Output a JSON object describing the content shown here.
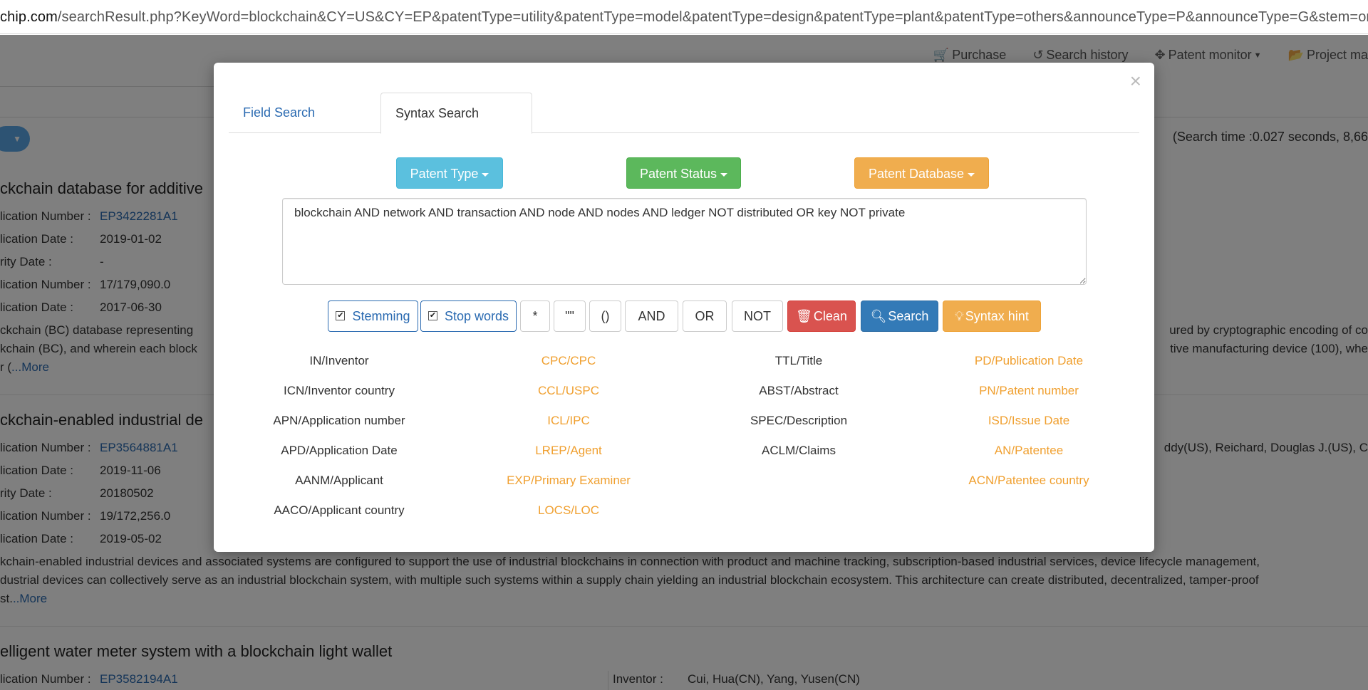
{
  "url": {
    "host": "chip.com",
    "path": "/searchResult.php?KeyWord=blockchain&CY=US&CY=EP&patentType=utility&patentType=model&patentType=design&patentType=plant&patentType=others&announceType=P&announceType=G&stem=on&"
  },
  "topnav": {
    "purchase": "Purchase",
    "history": "Search history",
    "monitor": "Patent monitor",
    "project": "Project ma"
  },
  "search_time": "(Search time :0.027 seconds, 8,66",
  "results": [
    {
      "title": "ckchain database for additive",
      "rows": [
        {
          "label": "lication Number :",
          "value": "EP3422281A1",
          "link": true
        },
        {
          "label": "lication Date :",
          "value": "2019-01-02"
        },
        {
          "label": "rity Date :",
          "value": "-"
        },
        {
          "label": "lication Number :",
          "value": "17/179,090.0"
        },
        {
          "label": "lication Date :",
          "value": "2017-06-30"
        }
      ],
      "abstract_1": "ckchain (BC) database representing",
      "abstract_1_right": "ured by cryptographic encoding of co",
      "abstract_2": "kchain (BC), and wherein each block",
      "abstract_2_right": "tive manufacturing device (100), whe",
      "abstract_3_prefix": "r (",
      "more": "...More"
    },
    {
      "title": "ckchain-enabled industrial de",
      "rows": [
        {
          "label": "lication Number :",
          "value": "EP3564881A1",
          "link": true
        },
        {
          "label": "lication Date :",
          "value": "2019-11-06"
        },
        {
          "label": "rity Date :",
          "value": "20180502"
        },
        {
          "label": "lication Number :",
          "value": "19/172,256.0"
        },
        {
          "label": "lication Date :",
          "value": "2019-05-02"
        }
      ],
      "inventor_right": "ddy(US), Reichard, Douglas J.(US), C",
      "abstract_1": "kchain-enabled industrial devices and associated systems are configured to support the use of industrial blockchains in connection with product and machine tracking, subscription-based industrial services, device lifecycle management,",
      "abstract_2": "dustrial devices can collectively serve as an industrial blockchain system, with multiple such systems within a supply chain yielding an industrial blockchain ecosystem. This architecture can create distributed, decentralized, tamper-proof",
      "abstract_3_prefix": "st.",
      "more": "..More"
    },
    {
      "title": "elligent water meter system with a blockchain light wallet",
      "rows": [
        {
          "label": "lication Number :",
          "value": "EP3582194A1",
          "link": true
        }
      ],
      "inventor_label": "Inventor :",
      "inventor_value": "Cui, Hua(CN), Yang, Yusen(CN)"
    }
  ],
  "modal": {
    "close": "×",
    "tabs": [
      "Field Search",
      "Syntax Search"
    ],
    "active_tab": "Syntax Search",
    "dropdowns": {
      "type": "Patent Type",
      "status": "Patent Status",
      "database": "Patent Database"
    },
    "query": "blockchain AND network AND transaction AND node AND nodes AND ledger NOT distributed OR key NOT private",
    "options": {
      "stemming": "Stemming",
      "stemming_checked": true,
      "stop_words": "Stop words",
      "stop_words_checked": true
    },
    "operators": [
      "*",
      "\"\"",
      "()",
      "AND",
      "OR",
      "NOT"
    ],
    "buttons": {
      "clean": "Clean",
      "search": "Search",
      "hint": "Syntax hint"
    },
    "fields": {
      "col1": [
        "IN/Inventor",
        "ICN/Inventor country",
        "APN/Application number",
        "APD/Application Date",
        "AANM/Applicant",
        "AACO/Applicant country"
      ],
      "col2": [
        "CPC/CPC",
        "CCL/USPC",
        "ICL/IPC",
        "LREP/Agent",
        "EXP/Primary Examiner",
        "LOCS/LOC"
      ],
      "col3": [
        "TTL/Title",
        "ABST/Abstract",
        "SPEC/Description",
        "ACLM/Claims"
      ],
      "col4": [
        "PD/Publication Date",
        "PN/Patent number",
        "ISD/Issue Date",
        "AN/Patentee",
        "ACN/Patentee country"
      ]
    },
    "colors": {
      "info": "#5bc0de",
      "success": "#5cb85c",
      "warning": "#f0ad4e",
      "danger": "#d9534f",
      "primary": "#337ab7",
      "field_link": "#f0a030"
    }
  }
}
